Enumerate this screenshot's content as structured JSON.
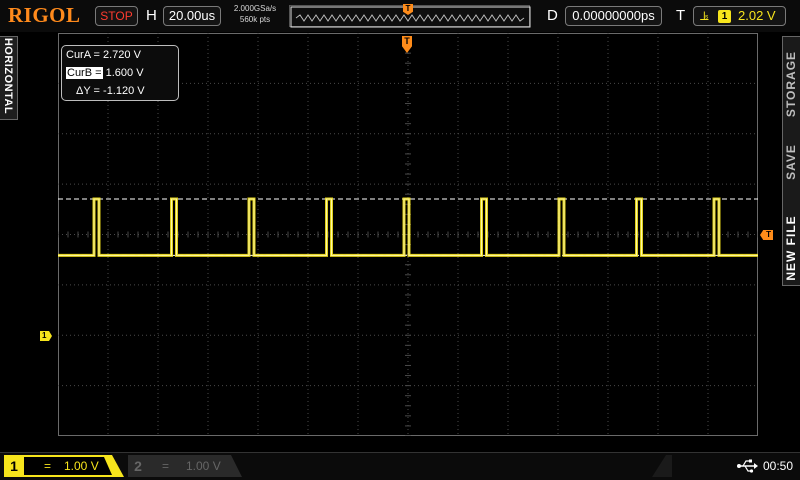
{
  "header": {
    "brand": "RIGOL",
    "run_state": "STOP",
    "horizontal_label": "H",
    "timebase": "20.00us",
    "sample_rate": "2.000GSa/s",
    "memory_depth": "560k pts",
    "delay_label": "D",
    "delay": "0.00000000ps",
    "trigger_label": "T",
    "trigger_source": "1",
    "trigger_level": "2.02 V"
  },
  "side_tabs": {
    "left": "HORIZONTAL",
    "right": [
      "STORAGE",
      "SAVE",
      "NEW FILE"
    ]
  },
  "cursor_readout": {
    "cura_label": "CurA =",
    "cura_value": "2.720 V",
    "curb_label": "CurB =",
    "curb_value": "1.600 V",
    "delta_label": "ΔY =",
    "delta_value": "-1.120 V"
  },
  "markers": {
    "trigger_pos": "T",
    "ch1_ground": "1",
    "trigger_level": "T"
  },
  "channels": [
    {
      "number": "1",
      "coupling": "=",
      "scale": "1.00 V",
      "active": true
    },
    {
      "number": "2",
      "coupling": "=",
      "scale": "1.00 V",
      "active": false
    }
  ],
  "status": {
    "time": "00:50",
    "usb_icon": "usb-icon"
  },
  "colors": {
    "ch1": "#f7e51c",
    "brand": "#ff8a1c",
    "trigger_marker": "#ff8c1a",
    "stop": "#ff3b2f",
    "grid": "#4a4a4a"
  },
  "waveform": {
    "volts_per_div": 1.0,
    "high_level_v": 2.72,
    "low_level_v": 1.6,
    "period_us": 31.0,
    "pulse_width_us": 2.0
  }
}
